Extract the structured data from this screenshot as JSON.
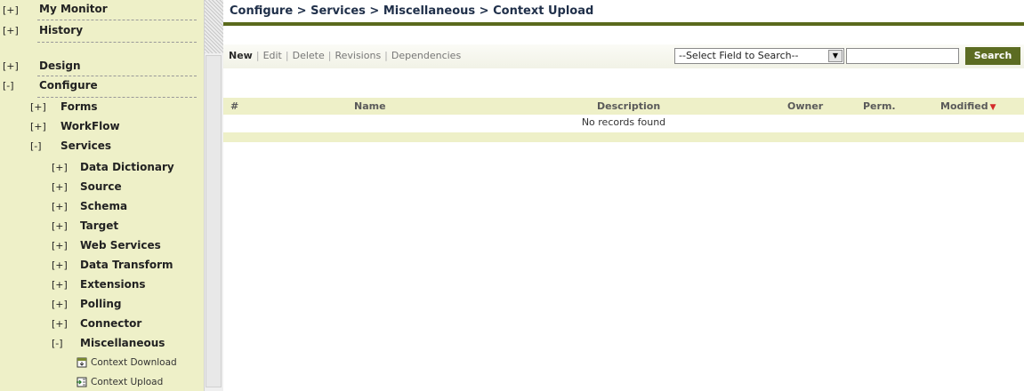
{
  "sidebar": {
    "nodes": [
      {
        "toggle": "[+]",
        "label": "My Monitor"
      },
      {
        "toggle": "[+]",
        "label": "History"
      },
      {
        "toggle": "[+]",
        "label": "Design"
      },
      {
        "toggle": "[-]",
        "label": "Configure"
      },
      {
        "toggle": "[+]",
        "label": "Forms"
      },
      {
        "toggle": "[+]",
        "label": "WorkFlow"
      },
      {
        "toggle": "[-]",
        "label": "Services"
      },
      {
        "toggle": "[+]",
        "label": "Data Dictionary"
      },
      {
        "toggle": "[+]",
        "label": "Source"
      },
      {
        "toggle": "[+]",
        "label": "Schema"
      },
      {
        "toggle": "[+]",
        "label": "Target"
      },
      {
        "toggle": "[+]",
        "label": "Web Services"
      },
      {
        "toggle": "[+]",
        "label": "Data Transform"
      },
      {
        "toggle": "[+]",
        "label": "Extensions"
      },
      {
        "toggle": "[+]",
        "label": "Polling"
      },
      {
        "toggle": "[+]",
        "label": "Connector"
      },
      {
        "toggle": "[-]",
        "label": "Miscellaneous"
      }
    ],
    "leaves": [
      {
        "icon": "context-download-icon",
        "label": "Context Download"
      },
      {
        "icon": "context-upload-icon",
        "label": "Context Upload"
      }
    ]
  },
  "main": {
    "breadcrumb": "Configure > Services > Miscellaneous > Context Upload",
    "actions": [
      "New",
      "Edit",
      "Delete",
      "Revisions",
      "Dependencies"
    ],
    "action_separator": "|",
    "search": {
      "select_value": "--Select Field to Search--",
      "input_value": "",
      "button_label": "Search"
    },
    "grid": {
      "columns": [
        "#",
        "Name",
        "Description",
        "Owner",
        "Perm.",
        "Modified"
      ],
      "sorted_column": "Modified",
      "sort_direction": "descending",
      "empty_message": "No records found"
    }
  },
  "colors": {
    "sidebar_bg": "#eef0c8",
    "accent_dark_olive": "#5c6c22",
    "breadcrumb_text": "#20304a",
    "sort_arrow": "#d42a2a"
  }
}
